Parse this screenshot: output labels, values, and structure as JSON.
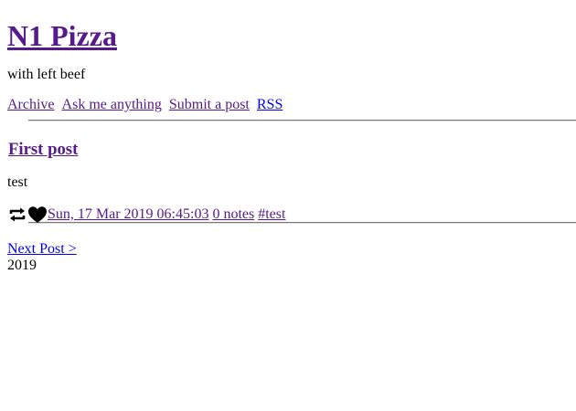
{
  "site": {
    "title": "N1 Pizza",
    "tagline": "with left beef"
  },
  "nav": {
    "items": [
      {
        "label": "Archive"
      },
      {
        "label": "Ask me anything"
      },
      {
        "label": "Submit a post"
      },
      {
        "label": "RSS"
      }
    ]
  },
  "post": {
    "title": "First post",
    "body": "test",
    "timestamp": "Sun, 17 Mar 2019 06:45:03",
    "notes": "0 notes",
    "tag": "#test",
    "icons": [
      "reblog-icon",
      "heart-icon"
    ]
  },
  "pager": {
    "next_label": "Next Post >"
  },
  "footer": {
    "year": "2019"
  },
  "colors": {
    "visited_link": "#551a8b",
    "unvisited_link": "#0000ee",
    "rule": "#7a7a7a"
  }
}
